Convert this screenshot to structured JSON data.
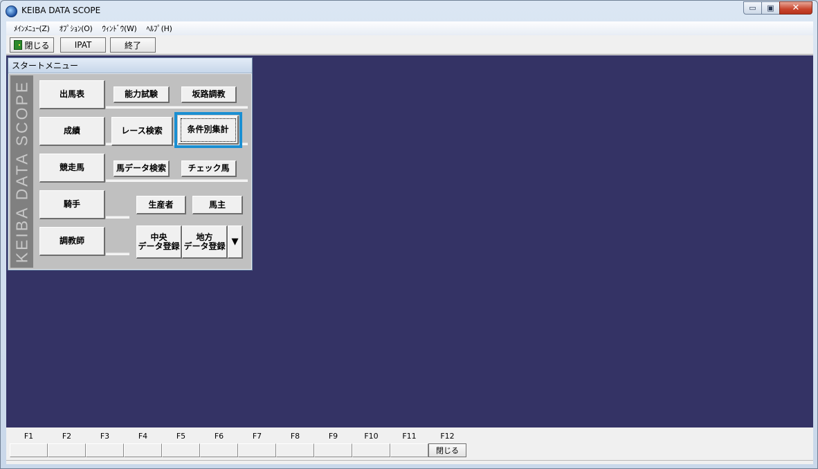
{
  "window": {
    "title": "KEIBA DATA SCOPE",
    "icon": "globe-horse-icon",
    "controls": {
      "minimize": "▭",
      "maximize": "▣",
      "close": "✕"
    }
  },
  "menubar": {
    "items": [
      "ﾒｲﾝﾒﾆｭｰ(Z)",
      "ｵﾌﾟｼｮﾝ(O)",
      "ｳｨﾝﾄﾞｳ(W)",
      "ﾍﾙﾌﾟ(H)"
    ]
  },
  "toolbar": {
    "close_label": "閉じる",
    "ipat_label": "IPAT",
    "exit_label": "終了"
  },
  "start_menu": {
    "title": "スタートメニュー",
    "brand": "KEIBA DATA SCOPE",
    "main_buttons": [
      "出馬表",
      "成績",
      "競走馬",
      "騎手",
      "調教師"
    ],
    "sub_buttons": {
      "ability_test": "能力試験",
      "hill_training": "坂路調教",
      "race_search": "レース検索",
      "conditional_stats": "条件別集計",
      "horse_data_search": "馬データ検索",
      "check_horse": "チェック馬",
      "breeder": "生産者",
      "owner": "馬主",
      "central_line1": "中央",
      "central_line2": "データ登録",
      "local_line1": "地方",
      "local_line2": "データ登録",
      "dropdown": "▼"
    },
    "focused_button": "条件別集計"
  },
  "fkeys": {
    "labels": [
      "F1",
      "F2",
      "F3",
      "F4",
      "F5",
      "F6",
      "F7",
      "F8",
      "F9",
      "F10",
      "F11",
      "F12"
    ],
    "f12_button": "閉じる"
  },
  "colors": {
    "mdi_background": "#343365",
    "focus_frame": "#1a8fd2",
    "brand_strip": "#808080"
  }
}
